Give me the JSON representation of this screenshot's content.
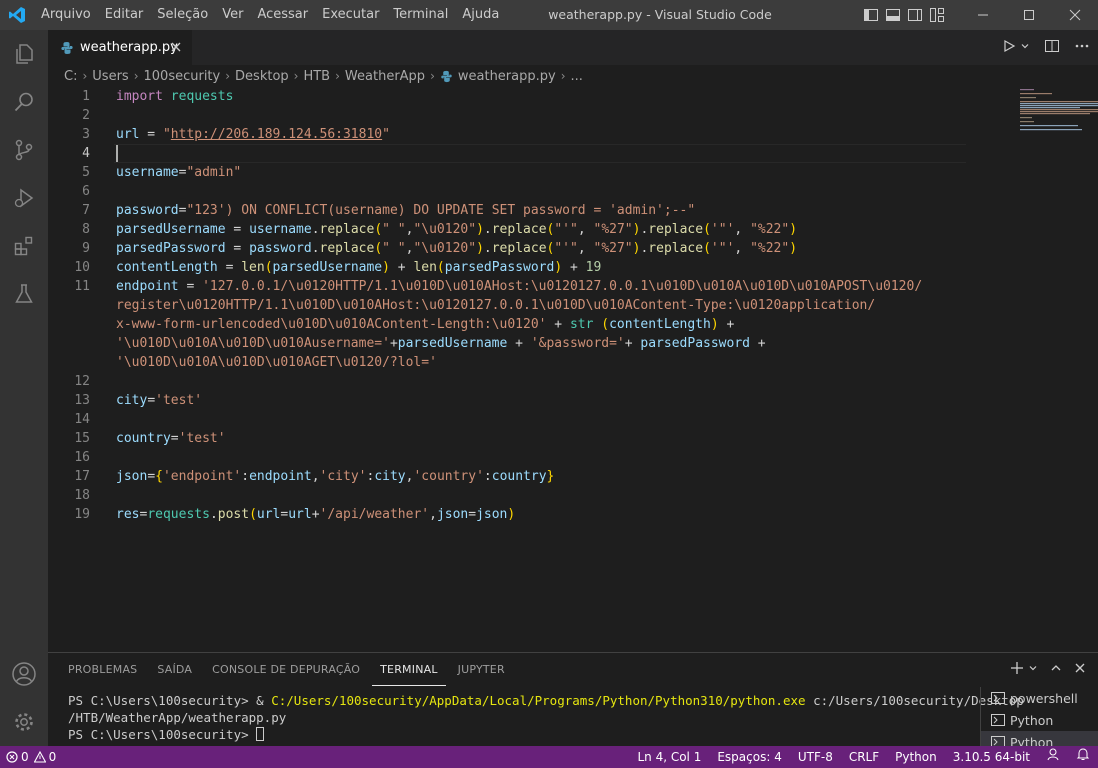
{
  "titlebar": {
    "title": "weatherapp.py - Visual Studio Code",
    "menu": [
      "Arquivo",
      "Editar",
      "Seleção",
      "Ver",
      "Acessar",
      "Executar",
      "Terminal",
      "Ajuda"
    ]
  },
  "tab": {
    "label": "weatherapp.py"
  },
  "breadcrumb": [
    "C:",
    "Users",
    "100security",
    "Desktop",
    "HTB",
    "WeatherApp",
    "weatherapp.py",
    "..."
  ],
  "editor": {
    "line_numbers": [
      "1",
      "2",
      "3",
      "4",
      "5",
      "6",
      "7",
      "8",
      "9",
      "10",
      "11",
      "",
      "",
      "",
      "",
      "12",
      "13",
      "14",
      "15",
      "16",
      "17",
      "18",
      "19"
    ],
    "active_line": 4
  },
  "panel": {
    "tabs": [
      "PROBLEMAS",
      "SAÍDA",
      "CONSOLE DE DEPURAÇÃO",
      "TERMINAL",
      "JUPYTER"
    ],
    "active_tab": "TERMINAL",
    "terminal": {
      "prompt": "PS C:\\Users\\100security> ",
      "cmd_prefix": "& ",
      "python_path": "C:/Users/100security/AppData/Local/Programs/Python/Python310/python.exe",
      "script_arg": " c:/Users/100security/Desktop",
      "script_arg_cont": "/HTB/WeatherApp/weatherapp.py",
      "prompt2": "PS C:\\Users\\100security> "
    },
    "terminals": [
      "powershell",
      "Python",
      "Python"
    ]
  },
  "statusbar": {
    "errors": "0",
    "warnings": "0",
    "position": "Ln 4, Col 1",
    "spaces": "Espaços: 4",
    "encoding": "UTF-8",
    "eol": "CRLF",
    "language": "Python",
    "interpreter": "3.10.5 64-bit"
  },
  "colors": {
    "statusbar": "#68217a",
    "titlebar": "#3c3c3c",
    "editor_bg": "#1e1e1e",
    "activity_bar": "#333333"
  }
}
